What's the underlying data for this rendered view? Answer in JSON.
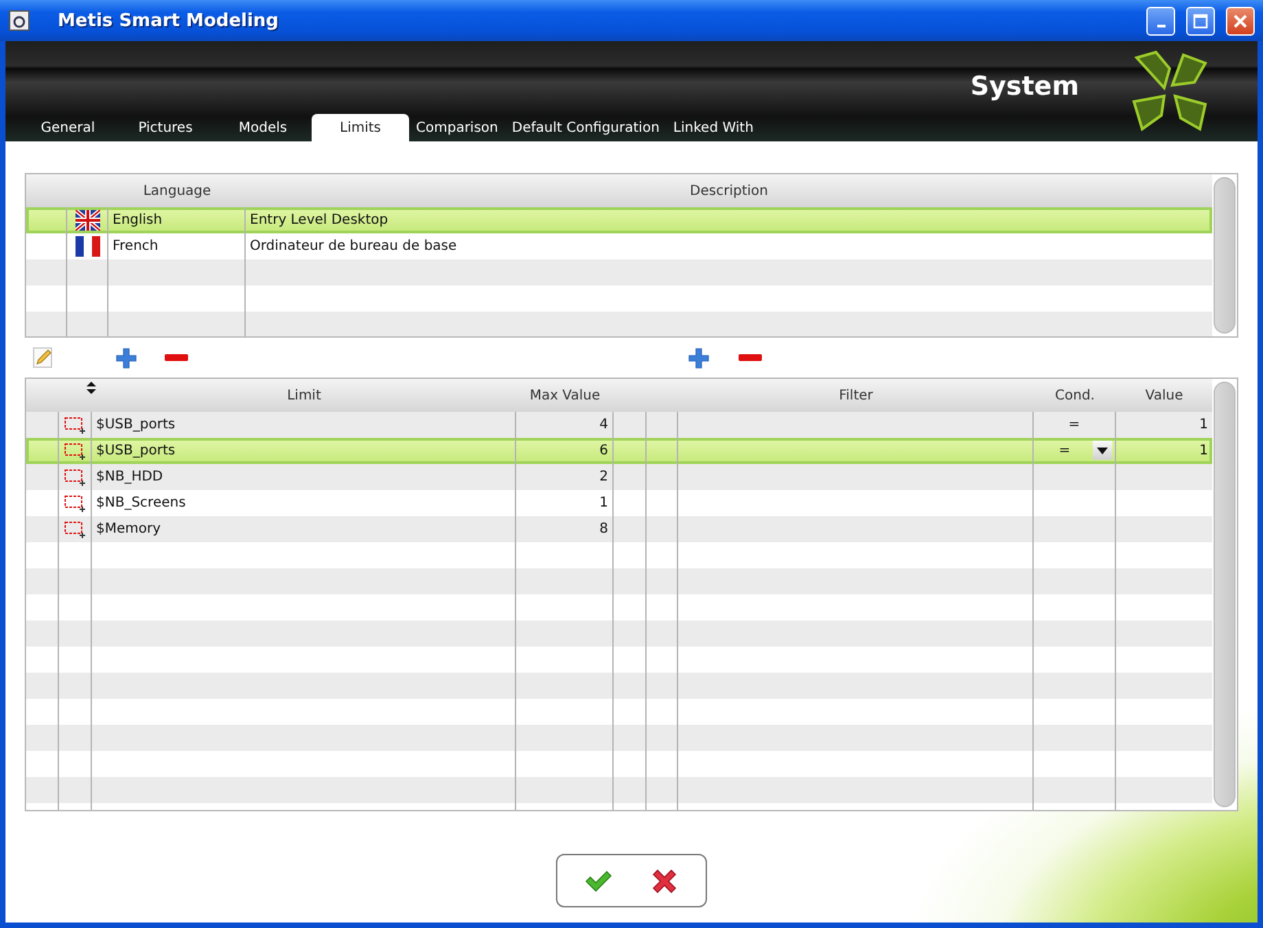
{
  "window": {
    "title": "Metis Smart Modeling"
  },
  "header": {
    "title": "System"
  },
  "tabs": [
    {
      "label": "General",
      "selected": false
    },
    {
      "label": "Pictures",
      "selected": false
    },
    {
      "label": "Models",
      "selected": false
    },
    {
      "label": "Limits",
      "selected": true
    },
    {
      "label": "Comparison",
      "selected": false
    },
    {
      "label": "Default Configuration",
      "selected": false
    },
    {
      "label": "Linked With",
      "selected": false
    }
  ],
  "languages": {
    "columns": [
      "Language",
      "Description"
    ],
    "rows": [
      {
        "kind": "union-jack",
        "language": "English",
        "description": "Entry Level Desktop",
        "selected": true
      },
      {
        "kind": "tricolour",
        "language": "French",
        "description": "Ordinateur de bureau de base",
        "selected": false
      }
    ]
  },
  "limits": {
    "columns": [
      "Limit",
      "Max Value",
      "Filter",
      "Cond.",
      "Value"
    ],
    "rows": [
      {
        "limit": "$USB_ports",
        "max_value": "4",
        "cond": "=",
        "value": "1",
        "selected": false
      },
      {
        "limit": "$USB_ports",
        "max_value": "6",
        "cond": "=",
        "value": "1",
        "selected": true
      },
      {
        "limit": "$NB_HDD",
        "max_value": "2",
        "selected": false
      },
      {
        "limit": "$NB_Screens",
        "max_value": "1",
        "selected": false
      },
      {
        "limit": "$Memory",
        "max_value": "8",
        "selected": false
      }
    ]
  }
}
